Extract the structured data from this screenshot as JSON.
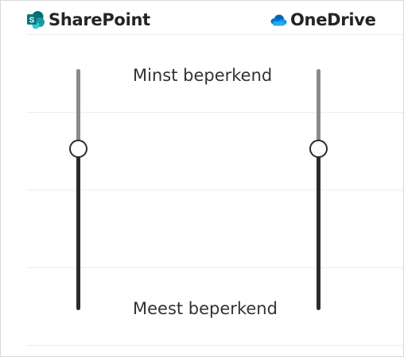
{
  "sharepoint": {
    "title": "SharePoint",
    "icon": "sharepoint-logo-icon",
    "slider": {
      "level_from_bottom": 0.67
    }
  },
  "onedrive": {
    "title": "OneDrive",
    "icon": "onedrive-cloud-icon",
    "slider": {
      "level_from_bottom": 0.67
    }
  },
  "scale": {
    "top_label": "Minst beperkend",
    "bottom_label": "Meest beperkend"
  },
  "colors": {
    "sharepoint_brand": "#03787c",
    "onedrive_brand": "#0364b8",
    "track_active": "#2b2b2b",
    "track_inactive": "#8a8a8a"
  }
}
